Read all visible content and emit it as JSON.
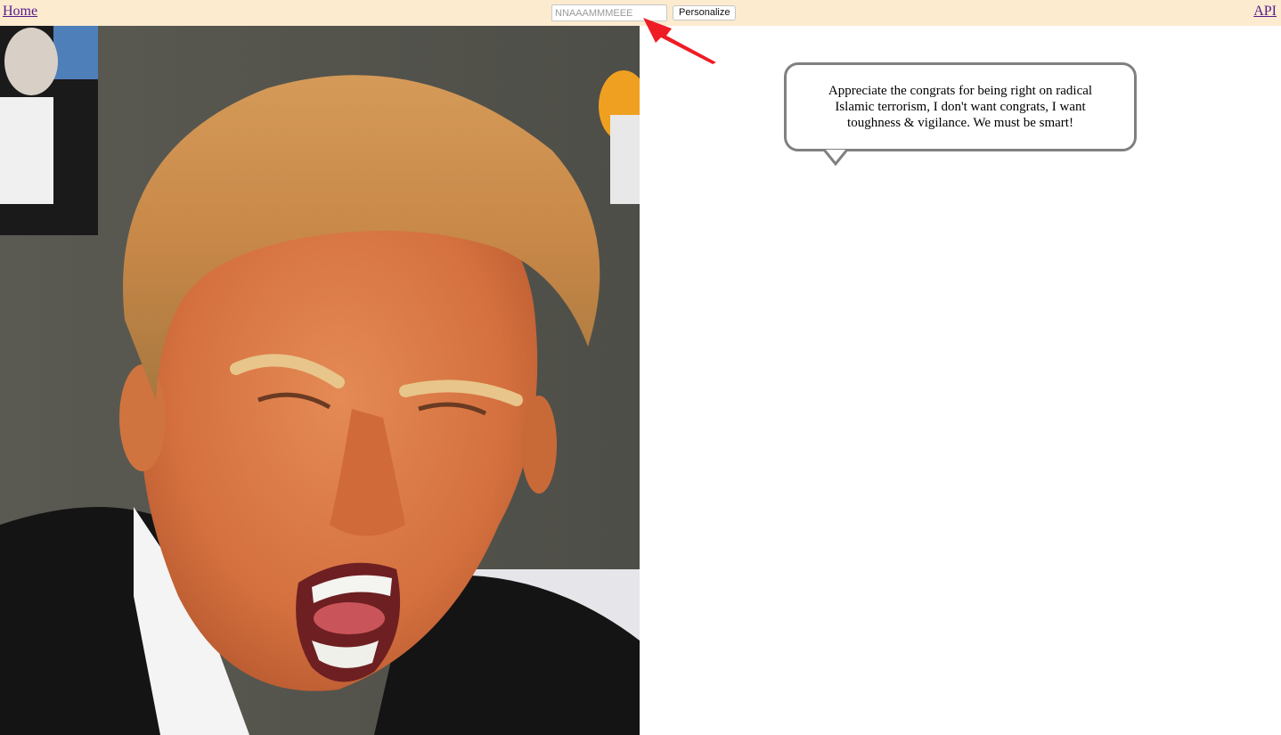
{
  "topbar": {
    "home_label": "Home",
    "api_label": "API",
    "name_input_placeholder": "NNAAAMMMEEE",
    "personalize_label": "Personalize",
    "background": "#fdebd0"
  },
  "quote": {
    "text": "Appreciate the congrats for being right on radical Islamic terrorism, I don't want congrats, I want toughness & vigilance. We must be smart!"
  },
  "icons": {
    "annotation_arrow": "red-arrow-icon",
    "bubble_tail": "speech-bubble-tail-icon"
  },
  "colors": {
    "link": "#551a8b",
    "bubble_border": "#808080",
    "arrow": "#ee1c25"
  }
}
